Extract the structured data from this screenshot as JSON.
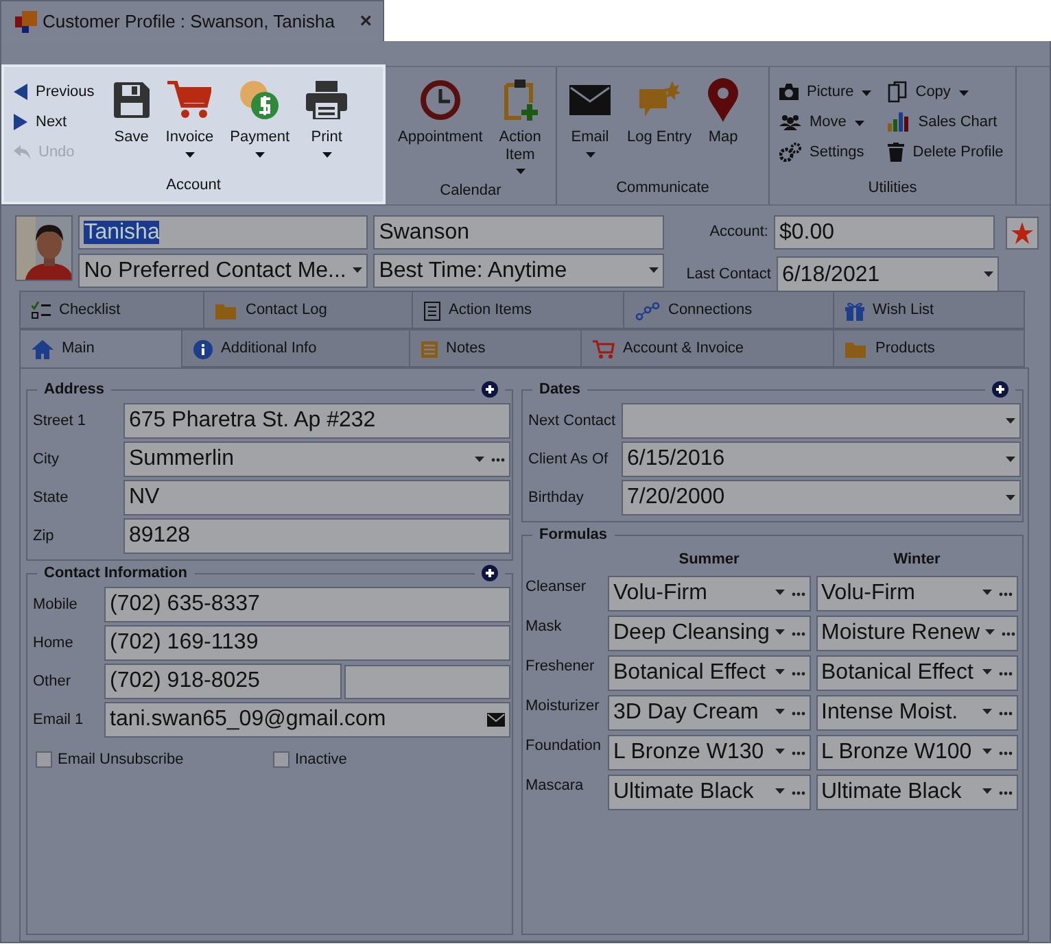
{
  "document_tab": {
    "title": "Customer Profile : Swanson, Tanisha",
    "close": "×"
  },
  "ribbon": [
    {
      "label": "Account",
      "highlighted": true,
      "items": [
        {
          "kind": "small",
          "label": "Previous",
          "disabled": false
        },
        {
          "kind": "small",
          "label": "Next",
          "disabled": false
        },
        {
          "kind": "small",
          "label": "Undo",
          "disabled": true
        },
        {
          "kind": "large",
          "label": "Save",
          "dropdown": false
        },
        {
          "kind": "large",
          "label": "Invoice",
          "dropdown": true
        },
        {
          "kind": "large",
          "label": "Payment",
          "dropdown": true
        },
        {
          "kind": "large",
          "label": "Print",
          "dropdown": true
        }
      ]
    },
    {
      "label": "Calendar",
      "highlighted": false,
      "items": [
        {
          "kind": "large",
          "label": "Appointment",
          "dropdown": false
        },
        {
          "kind": "large",
          "label": "Action Item",
          "dropdown": true
        }
      ]
    },
    {
      "label": "Communicate",
      "highlighted": false,
      "items": [
        {
          "kind": "large",
          "label": "Email",
          "dropdown": true
        },
        {
          "kind": "large",
          "label": "Log Entry",
          "dropdown": false
        },
        {
          "kind": "large",
          "label": "Map",
          "dropdown": false
        }
      ]
    },
    {
      "label": "Utilities",
      "highlighted": false,
      "items": [
        {
          "kind": "small",
          "label": "Picture",
          "dropdown": true
        },
        {
          "kind": "small",
          "label": "Move",
          "dropdown": true
        },
        {
          "kind": "small",
          "label": "Settings",
          "dropdown": false
        },
        {
          "kind": "small",
          "label": "Copy",
          "dropdown": true
        },
        {
          "kind": "small",
          "label": "Sales Chart",
          "dropdown": false
        },
        {
          "kind": "small",
          "label": "Delete Profile",
          "dropdown": false
        }
      ]
    }
  ],
  "header": {
    "first_name": {
      "value": "Tanisha",
      "text_selected": true
    },
    "last_name": {
      "value": "Swanson"
    },
    "contact_method": {
      "value": "No Preferred Contact Me..."
    },
    "best_time": {
      "value": "Best Time: Anytime"
    },
    "account": {
      "label": "Account:",
      "value": "$0.00"
    },
    "favorite": true,
    "last_contact": {
      "label": "Last Contact",
      "value": "6/18/2021"
    }
  },
  "tabs": [
    [
      {
        "label": "Checklist",
        "selected": false
      },
      {
        "label": "Contact Log",
        "selected": false
      },
      {
        "label": "Action Items",
        "selected": false
      },
      {
        "label": "Connections",
        "selected": false
      },
      {
        "label": "Wish List",
        "selected": false
      }
    ],
    [
      {
        "label": "Main",
        "selected": true
      },
      {
        "label": "Additional Info",
        "selected": false
      },
      {
        "label": "Notes",
        "selected": false
      },
      {
        "label": "Account & Invoice",
        "selected": false
      },
      {
        "label": "Products",
        "selected": false
      }
    ]
  ],
  "address": {
    "title": "Address",
    "fields": [
      {
        "label": "Street 1",
        "kind": "text",
        "value": "675 Pharetra St. Ap #232"
      },
      {
        "label": "City",
        "kind": "combo",
        "value": "Summerlin"
      },
      {
        "label": "State",
        "kind": "text",
        "value": "NV"
      },
      {
        "label": "Zip",
        "kind": "text",
        "value": "89128"
      }
    ]
  },
  "contact_information": {
    "title": "Contact Information",
    "fields": [
      {
        "label": "Mobile",
        "kind": "text",
        "value": "(702) 635-8337"
      },
      {
        "label": "Home",
        "kind": "text",
        "value": "(702) 169-1139"
      },
      {
        "label": "Other",
        "kind": "split",
        "value": "(702) 918-8025"
      },
      {
        "label": "Email 1",
        "kind": "email",
        "value": "tani.swan65_09@gmail.com"
      }
    ],
    "checkboxes": [
      {
        "label": "Email Unsubscribe",
        "checked": false
      },
      {
        "label": "Inactive",
        "checked": false
      }
    ]
  },
  "dates": {
    "title": "Dates",
    "fields": [
      {
        "label": "Next Contact",
        "kind": "date"
      },
      {
        "label": "Client As Of",
        "kind": "date",
        "value": "6/15/2016"
      },
      {
        "label": "Birthday",
        "kind": "date",
        "value": "7/20/2000"
      }
    ]
  },
  "formulas": {
    "title": "Formulas",
    "columns": [
      "Summer",
      "Winter"
    ],
    "rows": [
      {
        "label": "Cleanser",
        "values": [
          "Volu-Firm",
          "Volu-Firm"
        ]
      },
      {
        "label": "Mask",
        "values": [
          "Deep Cleansing",
          "Moisture Renew"
        ]
      },
      {
        "label": "Freshener",
        "values": [
          "Botanical Effect",
          "Botanical Effect"
        ]
      },
      {
        "label": "Moisturizer",
        "values": [
          "3D Day Cream",
          "Intense Moist."
        ]
      },
      {
        "label": "Foundation",
        "values": [
          "L Bronze W130",
          "L Bronze W100"
        ]
      },
      {
        "label": "Mascara",
        "values": [
          "Ultimate Black",
          "Ultimate Black"
        ]
      }
    ]
  }
}
